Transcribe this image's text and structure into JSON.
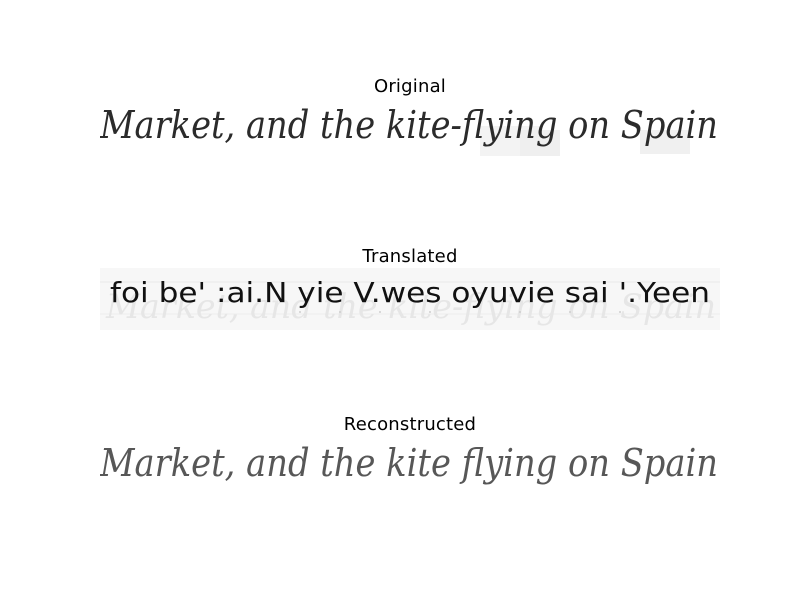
{
  "panels": [
    {
      "title": "Original",
      "text": "Market, and the kite-flying on Spain"
    },
    {
      "title": "Translated",
      "text": "foi be' :ai.N yie V.wes oyuvie sai '.Yeen"
    },
    {
      "title": "Reconstructed",
      "text": "Market, and the kite flying on Spain"
    }
  ]
}
